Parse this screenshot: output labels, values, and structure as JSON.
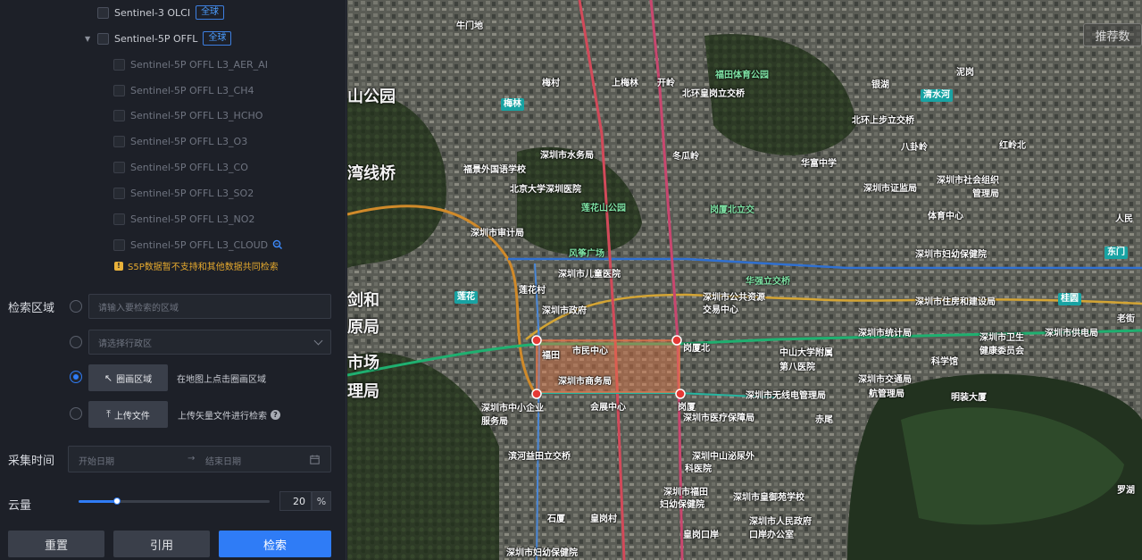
{
  "tree": {
    "olci": {
      "label": "Sentinel-3 OLCI",
      "tag": "全球"
    },
    "s5p": {
      "label": "Sentinel-5P OFFL",
      "tag": "全球"
    },
    "s5p_children": [
      "Sentinel-5P OFFL L3_AER_AI",
      "Sentinel-5P OFFL L3_CH4",
      "Sentinel-5P OFFL L3_HCHO",
      "Sentinel-5P OFFL L3_O3",
      "Sentinel-5P OFFL L3_CO",
      "Sentinel-5P OFFL L3_SO2",
      "Sentinel-5P OFFL L3_NO2",
      "Sentinel-5P OFFL L3_CLOUD"
    ],
    "notice": "S5P数据暂不支持和其他数据共同检索"
  },
  "region": {
    "label": "检索区域",
    "search_placeholder": "请输入要检索的区域",
    "admin_placeholder": "请选择行政区",
    "draw_button": "圈画区域",
    "draw_hint": "在地图上点击圈画区域",
    "upload_button": "上传文件",
    "upload_hint": "上传矢量文件进行检索",
    "selected_option": "draw"
  },
  "time": {
    "label": "采集时间",
    "start_placeholder": "开始日期",
    "separator": "→",
    "end_placeholder": "结束日期"
  },
  "cloud": {
    "label": "云量",
    "value": "20",
    "unit": "%",
    "fraction": 0.2
  },
  "footer": {
    "reset": "重置",
    "cite": "引用",
    "search": "检索"
  },
  "map": {
    "corner_button": "推荐数",
    "labels_big": [
      "湾线桥",
      "山公园",
      "剑和",
      "原局",
      "市场",
      "理局"
    ],
    "labels": [
      "牛门地",
      "梅村",
      "上梅林",
      "开岭",
      "北环皇岗立交桥",
      "福田体育公园",
      "银湖",
      "北环上步立交桥",
      "八卦岭",
      "深圳市水务局",
      "冬瓜岭",
      "福景外国语学校",
      "北京大学深圳医院",
      "莲花山公园",
      "深圳市审计局",
      "风筝广场",
      "深圳市儿童医院",
      "莲花村",
      "深圳市政府",
      "深圳市公共资源",
      "交易中心",
      "福田",
      "市民中心",
      "岗厦北",
      "深圳市商务局",
      "会展中心",
      "深圳市中小企业",
      "服务局",
      "岗厦",
      "中山大学附属",
      "第八医院",
      "深圳市统计局",
      "深圳市住房和建设局",
      "深圳市卫生",
      "健康委员会",
      "深圳市供电局",
      "深圳市证监局",
      "深圳市社会组织",
      "管理局",
      "深圳市妇幼保健院",
      "体育中心",
      "华富中学",
      "深圳市交通局",
      "航管理局",
      "科学馆",
      "赤尾",
      "深圳市医疗保障局",
      "深圳市无线电管理局",
      "滨河益田立交桥",
      "深圳中山泌尿外",
      "科医院",
      "深圳市福田",
      "妇幼保健院",
      "深圳市皇御苑学校",
      "深圳市人民政府",
      "口岸办公室",
      "石厦",
      "皇岗村",
      "皇岗口岸",
      "深圳市妇幼保健院",
      "岗厦北立交",
      "华强立交桥",
      "明装大厦",
      "泥岗",
      "红岭北",
      "人民",
      "老街",
      "罗湖"
    ],
    "badges": [
      "莲花",
      "梅林",
      "清水河",
      "东门",
      "桂圆"
    ]
  }
}
